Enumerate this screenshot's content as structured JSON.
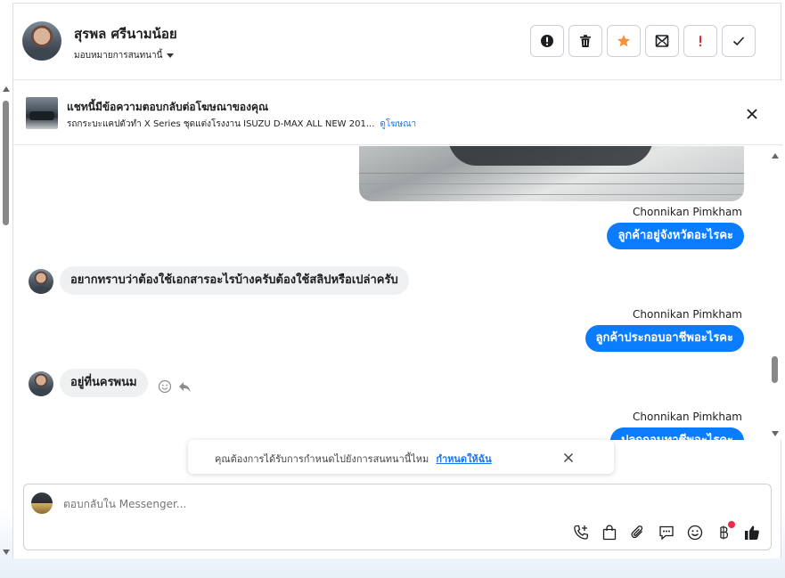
{
  "header": {
    "contact_name": "สุรพล ศรีนามน้อย",
    "assign_label": "มอบหมายการสนทนานี้",
    "actions": [
      {
        "name": "mark-spam-button",
        "icon": "alert-circle-icon"
      },
      {
        "name": "delete-button",
        "icon": "trash-icon"
      },
      {
        "name": "star-button",
        "icon": "star-icon",
        "color": "#f7923b"
      },
      {
        "name": "mark-unread-button",
        "icon": "envelope-icon"
      },
      {
        "name": "follow-up-button",
        "icon": "exclamation-icon",
        "color": "#e4252d"
      },
      {
        "name": "mark-done-button",
        "icon": "check-icon"
      }
    ]
  },
  "ad_banner": {
    "title": "แชทนี้มีข้อความตอบกลับต่อโฆษณาของคุณ",
    "subtitle": "รถกระบะแคปตัวทำ X Series ชุดแต่งโรงงาน ISUZU D-MAX ALL NEW 201...",
    "link": "ดูโฆษณา"
  },
  "messages": [
    {
      "direction": "out",
      "sender": "Chonnikan Pimkham",
      "text": "ลูกค้าอยู่จังหวัดอะไรคะ"
    },
    {
      "direction": "in",
      "text": "อยากทราบว่าต้องใช้เอกสารอะไรบ้างครับต้องใช้สลิปหรือเปล่าครับ"
    },
    {
      "direction": "out",
      "sender": "Chonnikan Pimkham",
      "text": "ลูกค้าประกอบอาชีพอะไรคะ"
    },
    {
      "direction": "in",
      "text": "อยู่ที่นครพนม"
    },
    {
      "direction": "out",
      "sender": "Chonnikan Pimkham",
      "text": "ปลูกถอนทาชีพอะไรคะ"
    }
  ],
  "toast": {
    "text": "คุณต้องการได้รับการกำหนดไปยังการสนทนานี้ไหม",
    "link": "กำหนดให้ฉัน"
  },
  "composer": {
    "placeholder": "ตอบกลับใน Messenger..."
  },
  "colors": {
    "accent": "#0a7cff",
    "link": "#1877f2",
    "incoming_bubble": "#eef0f2"
  }
}
